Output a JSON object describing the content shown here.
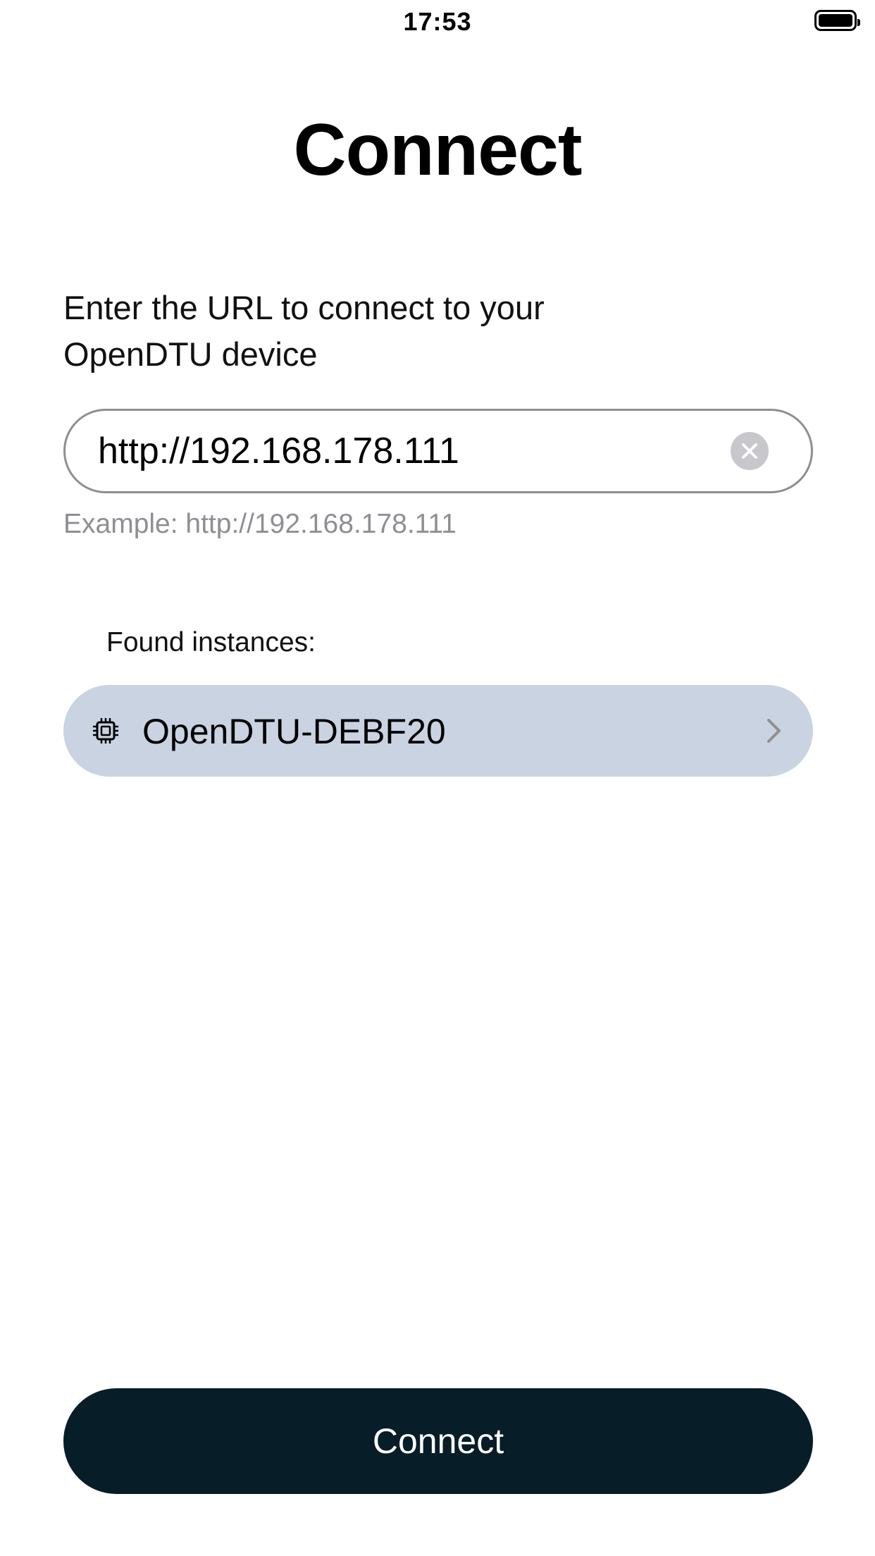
{
  "status_bar": {
    "time": "17:53",
    "battery_icon": "battery-full-icon"
  },
  "header": {
    "title": "Connect"
  },
  "form": {
    "instruction": "Enter the URL to connect to your OpenDTU device",
    "url_value": "http://192.168.178.111",
    "clear_icon": "clear-circle-x-icon",
    "example_hint": "Example: http://192.168.178.111"
  },
  "instances": {
    "label": "Found instances:",
    "items": [
      {
        "name": "OpenDTU-DEBF20",
        "icon": "cpu-chip-icon",
        "trailing_icon": "chevron-right-icon"
      }
    ]
  },
  "footer": {
    "connect_label": "Connect"
  },
  "colors": {
    "instance_background": "#cad3e1",
    "connect_button": "#071d28",
    "field_border": "#8e8e93",
    "hint_text": "#8e8e93"
  }
}
